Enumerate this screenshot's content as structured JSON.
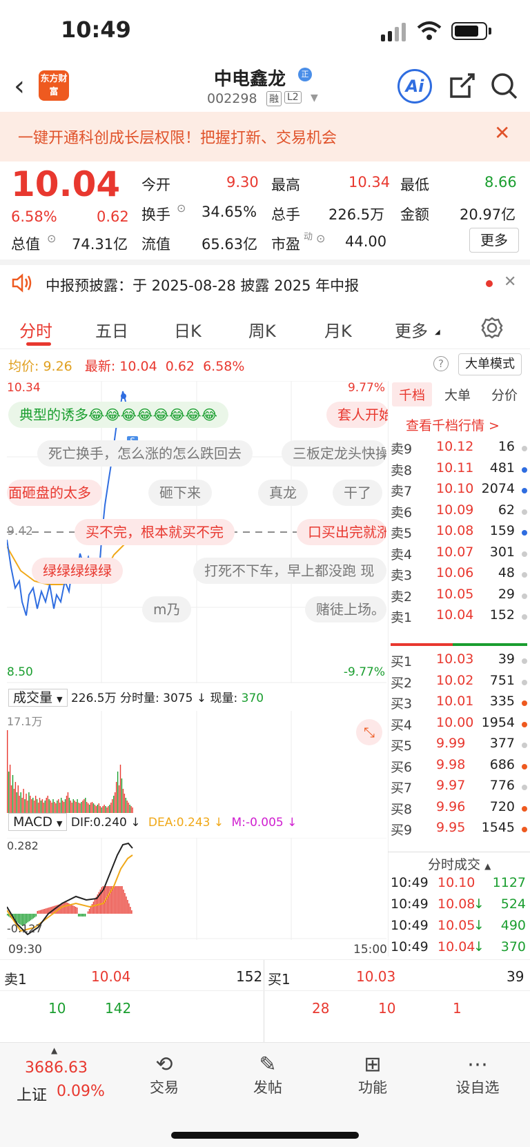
{
  "status": {
    "time": "10:49"
  },
  "header": {
    "logo_text": "东方财富",
    "stock_name": "中电鑫龙",
    "name_badge": "正",
    "code": "002298",
    "tag1": "融",
    "tag2": "L2"
  },
  "banner": {
    "text": "一键开通科创成长层权限！把握打新、交易机会"
  },
  "quote": {
    "price": "10.04",
    "change_pct": "6.58%",
    "change": "0.62",
    "open_label": "今开",
    "open": "9.30",
    "high_label": "最高",
    "high": "10.34",
    "low_label": "最低",
    "low": "8.66",
    "turnover_label": "换手",
    "turnover": "34.65%",
    "volume_label": "总手",
    "volume": "226.5万",
    "amount_label": "金额",
    "amount": "20.97亿",
    "mktcap_label": "总值",
    "mktcap": "74.31亿",
    "float_label": "流值",
    "float": "65.63亿",
    "pe_label": "市盈",
    "pe_sup": "动",
    "pe": "44.00",
    "more": "更多"
  },
  "notice": {
    "text": "中报预披露：于 2025-08-28 披露 2025 年中报"
  },
  "tabs": [
    "分时",
    "五日",
    "日K",
    "周K",
    "月K",
    "更多"
  ],
  "avgline": {
    "avg_label": "均价:",
    "avg": "9.26",
    "last_label": "最新:",
    "last": "10.04",
    "chg": "0.62",
    "pct": "6.58%",
    "mode": "大单模式"
  },
  "chart_axis": {
    "top_left": "10.34",
    "top_right": "9.77%",
    "mid": "9.42",
    "bottom_left": "8.50",
    "bottom_right": "-9.77%"
  },
  "danmu": [
    "典型的诱多😂😂😂😂😂😂😂😂",
    "套人开始",
    "死亡换手，怎么涨的怎么跌回去",
    "三板定龙头快操",
    "面砸盘的太多",
    "砸下来",
    "真龙",
    "干了",
    "买不完，根本就买不完",
    "口买出完就涨",
    "绿绿绿绿绿",
    "打死不下车，早上都没跑 现",
    "m乃",
    "赌徒上场。"
  ],
  "volume_bar": {
    "select": "成交量",
    "total": "226.5万",
    "fen_label": "分时量:",
    "fen": "3075",
    "now_label": "现量:",
    "now": "370",
    "max": "17.1万"
  },
  "macd_bar": {
    "select": "MACD",
    "dif": "DIF:0.240",
    "dea": "DEA:0.243",
    "m": "M:-0.005",
    "top": "0.282",
    "bottom": "-0.127",
    "time_start": "09:30",
    "time_end": "15:00"
  },
  "right_tabs": [
    "千档",
    "大单",
    "分价"
  ],
  "right_link": "查看千档行情 >",
  "sells": [
    {
      "l": "卖9",
      "p": "10.12",
      "v": "16",
      "dot": "#cccccc"
    },
    {
      "l": "卖8",
      "p": "10.11",
      "v": "481",
      "dot": "#2f6de0"
    },
    {
      "l": "卖7",
      "p": "10.10",
      "v": "2074",
      "dot": "#2f6de0"
    },
    {
      "l": "卖6",
      "p": "10.09",
      "v": "62",
      "dot": "#cccccc"
    },
    {
      "l": "卖5",
      "p": "10.08",
      "v": "159",
      "dot": "#2f6de0"
    },
    {
      "l": "卖4",
      "p": "10.07",
      "v": "301",
      "dot": "#cccccc"
    },
    {
      "l": "卖3",
      "p": "10.06",
      "v": "48",
      "dot": "#cccccc"
    },
    {
      "l": "卖2",
      "p": "10.05",
      "v": "29",
      "dot": "#cccccc"
    },
    {
      "l": "卖1",
      "p": "10.04",
      "v": "152",
      "dot": "#cccccc"
    }
  ],
  "buys": [
    {
      "l": "买1",
      "p": "10.03",
      "v": "39",
      "dot": "#cccccc"
    },
    {
      "l": "买2",
      "p": "10.02",
      "v": "751",
      "dot": "#cccccc"
    },
    {
      "l": "买3",
      "p": "10.01",
      "v": "335",
      "dot": "#ee5a20"
    },
    {
      "l": "买4",
      "p": "10.00",
      "v": "1954",
      "dot": "#ee5a20"
    },
    {
      "l": "买5",
      "p": "9.99",
      "v": "377",
      "dot": "#cccccc"
    },
    {
      "l": "买6",
      "p": "9.98",
      "v": "686",
      "dot": "#ee5a20"
    },
    {
      "l": "买7",
      "p": "9.97",
      "v": "776",
      "dot": "#cccccc"
    },
    {
      "l": "买8",
      "p": "9.96",
      "v": "720",
      "dot": "#ee5a20"
    },
    {
      "l": "买9",
      "p": "9.95",
      "v": "1545",
      "dot": "#ee5a20"
    }
  ],
  "ticks_title": "分时成交",
  "ticks": [
    {
      "t": "10:49",
      "p": "10.10",
      "arrow": "",
      "v": "1127"
    },
    {
      "t": "10:49",
      "p": "10.08",
      "arrow": "↓",
      "v": "524"
    },
    {
      "t": "10:49",
      "p": "10.05",
      "arrow": "↓",
      "v": "490"
    },
    {
      "t": "10:49",
      "p": "10.04",
      "arrow": "↓",
      "v": "370"
    }
  ],
  "bottom": {
    "sell_label": "卖1",
    "sell_price": "10.04",
    "sell_vol": "152",
    "buy_label": "买1",
    "buy_price": "10.03",
    "buy_vol": "39",
    "sell_q1": "10",
    "sell_q2": "142",
    "buy_q1": "28",
    "buy_q2": "10",
    "buy_q3": "1"
  },
  "dock": {
    "index_value": "3686.63",
    "index_name": "上证",
    "index_pct": "0.09%",
    "items": [
      "交易",
      "发帖",
      "功能",
      "设自选"
    ]
  }
}
